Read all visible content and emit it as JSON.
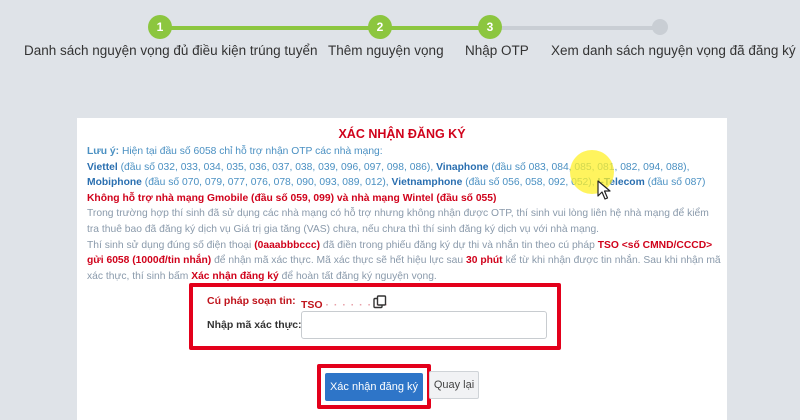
{
  "stepper": {
    "steps": [
      {
        "number": "1",
        "label": "Danh sách nguyện vọng đủ điều kiện trúng tuyển"
      },
      {
        "number": "2",
        "label": "Thêm nguyện vọng"
      },
      {
        "number": "3",
        "label": "Nhập OTP"
      },
      {
        "number": "",
        "label": "Xem danh sách nguyện vọng đã đăng ký"
      }
    ],
    "active_color": "#8cc63f",
    "inactive_color": "#c9ced4"
  },
  "panel": {
    "title": "XÁC NHẬN ĐĂNG KÝ",
    "note_label": "Lưu ý:",
    "note_intro": "Hiện tại đầu số 6058 chỉ hỗ trợ nhận OTP các nhà mạng:",
    "carriers": [
      {
        "name": "Viettel",
        "prefixes": "(đầu số 032, 033, 034, 035, 036, 037, 038, 039, 096, 097, 098, 086),"
      },
      {
        "name": "Vinaphone",
        "prefixes": "(đầu số 083, 084, 085, 081, 082, 094, 088),"
      },
      {
        "name": "Mobiphone",
        "prefixes": "(đầu số 070, 079, 077, 076, 078, 090, 093, 089, 012),"
      },
      {
        "name": "Vietnamphone",
        "prefixes": "(đầu số 056, 058, 092, 052),"
      },
      {
        "name": "I-Telecom",
        "prefixes": "(đầu số 087)"
      }
    ],
    "unsupported": "Không hỗ trợ nhà mạng Gmobile (đầu số 059, 099) và nhà mạng Wintel (đầu số 055)",
    "vas_note": "Trong trường hợp thí sinh đã sử dụng các nhà mạng có hỗ trợ nhưng không nhận được OTP, thí sinh vui lòng liên hệ nhà mạng để kiểm tra thuê bao đã đăng ký dịch vụ Giá trị gia tăng (VAS) chưa, nếu chưa thì thí sinh đăng ký dịch vụ với nhà mạng.",
    "phone_note_1": "Thí sinh sử dụng đúng số điện thoại",
    "phone_placeholder": "(0aaabbbccc)",
    "phone_note_2": "đã điền trong phiếu đăng ký dự thi và nhắn tin theo cú pháp",
    "sms_syntax": "TSO <số CMND/CCCD> gửi 6058 (1000đ/tin nhắn)",
    "phone_note_3": "để nhận mã xác thực. Mã xác thực sẽ hết hiệu lực sau",
    "validity": "30 phút",
    "phone_note_4": "kể từ khi nhận được tin nhắn. Sau khi nhận mã xác thực, thí sinh bấm",
    "confirm_ref": "Xác nhận đăng ký",
    "phone_note_5": "để hoàn tất đăng ký nguyện vọng."
  },
  "form": {
    "syntax_label": "Cú pháp soạn tin:",
    "syntax_value": "TSO ",
    "otp_label": "Nhập mã xác thực:",
    "otp_value": "",
    "otp_placeholder": ""
  },
  "buttons": {
    "confirm": "Xác nhận đăng ký",
    "back": "Quay lại"
  },
  "colors": {
    "title_red": "#d0021b",
    "note_blue": "#4a90c2",
    "primary_button": "#2e75c8",
    "annotation_border": "#e3001b"
  }
}
